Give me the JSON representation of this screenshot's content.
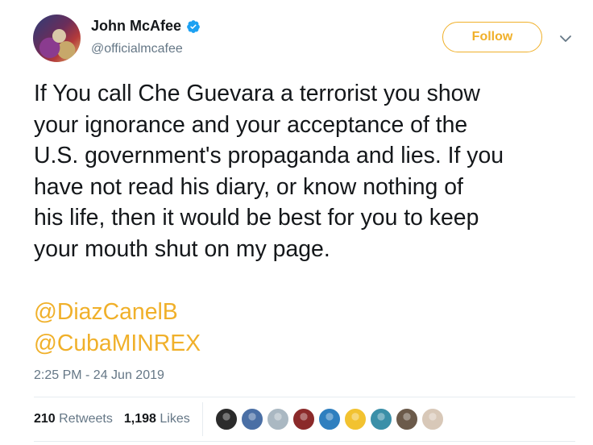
{
  "tweet": {
    "author": {
      "name": "John McAfee",
      "handle": "@officialmcafee",
      "verified": true
    },
    "follow_label": "Follow",
    "text_lines": [
      "If You call Che Guevara a terrorist you show",
      "your ignorance and your acceptance of the",
      "U.S. government's propaganda and lies. If you",
      "have not read his diary, or know nothing of",
      "his life, then it would be best for you to keep",
      "your mouth shut on my page."
    ],
    "mentions": [
      "@DiazCanelB",
      "@CubaMINREX"
    ],
    "timestamp": "2:25 PM - 24 Jun 2019",
    "stats": {
      "retweets_count": "210",
      "retweets_label": "Retweets",
      "likes_count": "1,198",
      "likes_label": "Likes"
    },
    "likers": [
      {
        "icon": "liker-avatar-1",
        "color": "#2b2b2b"
      },
      {
        "icon": "liker-avatar-2",
        "color": "#4a6fa5"
      },
      {
        "icon": "liker-avatar-3",
        "color": "#aab8c2"
      },
      {
        "icon": "liker-avatar-4",
        "color": "#8b2a2a"
      },
      {
        "icon": "liker-avatar-5",
        "color": "#2f7fbf"
      },
      {
        "icon": "liker-avatar-6",
        "color": "#f2c230"
      },
      {
        "icon": "liker-avatar-7",
        "color": "#3a8fa8"
      },
      {
        "icon": "liker-avatar-8",
        "color": "#6b5a4a"
      },
      {
        "icon": "liker-avatar-9",
        "color": "#d8c8b8"
      }
    ]
  },
  "colors": {
    "accent": "#f0b02a",
    "secondary_text": "#657786",
    "verified": "#1da1f2"
  }
}
